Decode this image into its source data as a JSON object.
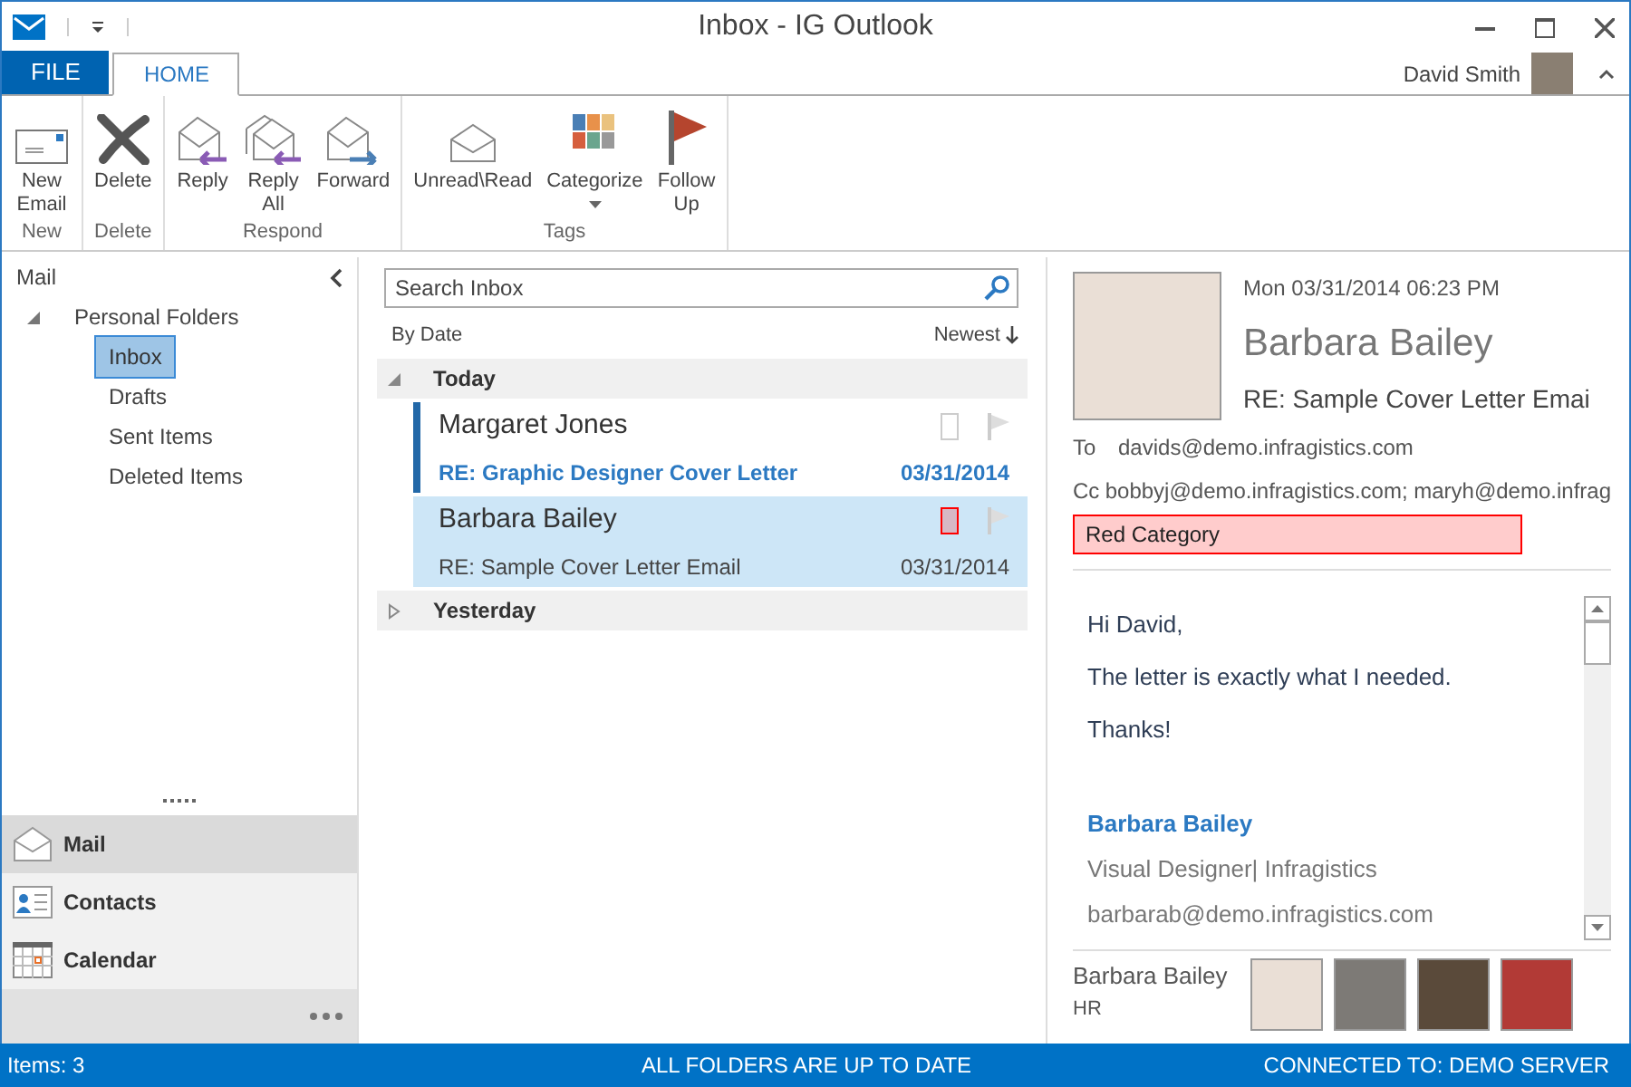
{
  "window": {
    "title": "Inbox - IG Outlook"
  },
  "tabs": [
    {
      "label": "FILE",
      "kind": "file",
      "selected": false
    },
    {
      "label": "HOME",
      "kind": "tab",
      "selected": true
    }
  ],
  "user": {
    "name": "David Smith"
  },
  "ribbon": {
    "groups": [
      {
        "label": "New",
        "buttons": [
          {
            "label": "New Email",
            "kind": "new"
          }
        ]
      },
      {
        "label": "Delete",
        "buttons": [
          {
            "label": "Delete",
            "kind": "delete"
          }
        ]
      },
      {
        "label": "Respond",
        "buttons": [
          {
            "label": "Reply",
            "kind": "reply"
          },
          {
            "label": "Reply All",
            "kind": "replyall"
          },
          {
            "label": "Forward",
            "kind": "forward"
          }
        ]
      },
      {
        "label": "Tags",
        "buttons": [
          {
            "label": "Unread\\Read",
            "kind": "unread"
          },
          {
            "label": "Categorize",
            "kind": "categorize",
            "dropdown": true
          },
          {
            "label": "Follow Up",
            "kind": "flag"
          }
        ]
      }
    ]
  },
  "navigation": {
    "header": "Mail",
    "tree": [
      {
        "label": "Personal Folders",
        "expanded": true,
        "children": [
          {
            "label": "Inbox",
            "selected": true
          },
          {
            "label": "Drafts",
            "selected": false
          },
          {
            "label": "Sent Items",
            "selected": false
          },
          {
            "label": "Deleted Items",
            "selected": false
          }
        ]
      }
    ],
    "modules": [
      {
        "label": "Mail",
        "kind": "mail",
        "selected": true
      },
      {
        "label": "Contacts",
        "kind": "contacts",
        "selected": false
      },
      {
        "label": "Calendar",
        "kind": "calendar",
        "selected": false
      }
    ]
  },
  "message_list": {
    "search": {
      "placeholder": "Search Inbox"
    },
    "sort": "By Date",
    "order": "Newest",
    "groups": [
      {
        "label": "Today",
        "expanded": true,
        "messages": [
          {
            "sender": "Margaret Jones",
            "subject": "RE: Graphic Designer Cover Letter",
            "date": "03/31/2014",
            "unread": true,
            "selected": false
          },
          {
            "sender": "Barbara Bailey",
            "subject": "RE: Sample Cover Letter Email",
            "date": "03/31/2014",
            "unread": false,
            "selected": true,
            "color": "#ff0000"
          }
        ]
      },
      {
        "label": "Yesterday",
        "expanded": false
      }
    ]
  },
  "reading_pane": {
    "date": "Mon 03/31/2014 06:23 PM",
    "sender": "Barbara Bailey",
    "subject": "RE: Sample Cover Letter Emai",
    "to_label": "To",
    "to": "davids@demo.infragistics.com",
    "cc_label": "Cc",
    "cc": "bobbyj@demo.infragistics.com; maryh@demo.infrag",
    "category": {
      "label": "Red Category",
      "color": "#ff0000"
    },
    "body": [
      "Hi David,",
      "The letter is exactly what I needed.",
      "Thanks!"
    ],
    "signature": {
      "name": "Barbara Bailey",
      "title": "Visual Designer| Infragistics",
      "email": "barbarab@demo.infragistics.com"
    },
    "people": {
      "name": "Barbara Bailey",
      "department": "HR"
    }
  },
  "status_bar": {
    "items": "Items:  3",
    "sync": "ALL FOLDERS ARE UP TO DATE",
    "connection": "CONNECTED TO: DEMO SERVER"
  }
}
